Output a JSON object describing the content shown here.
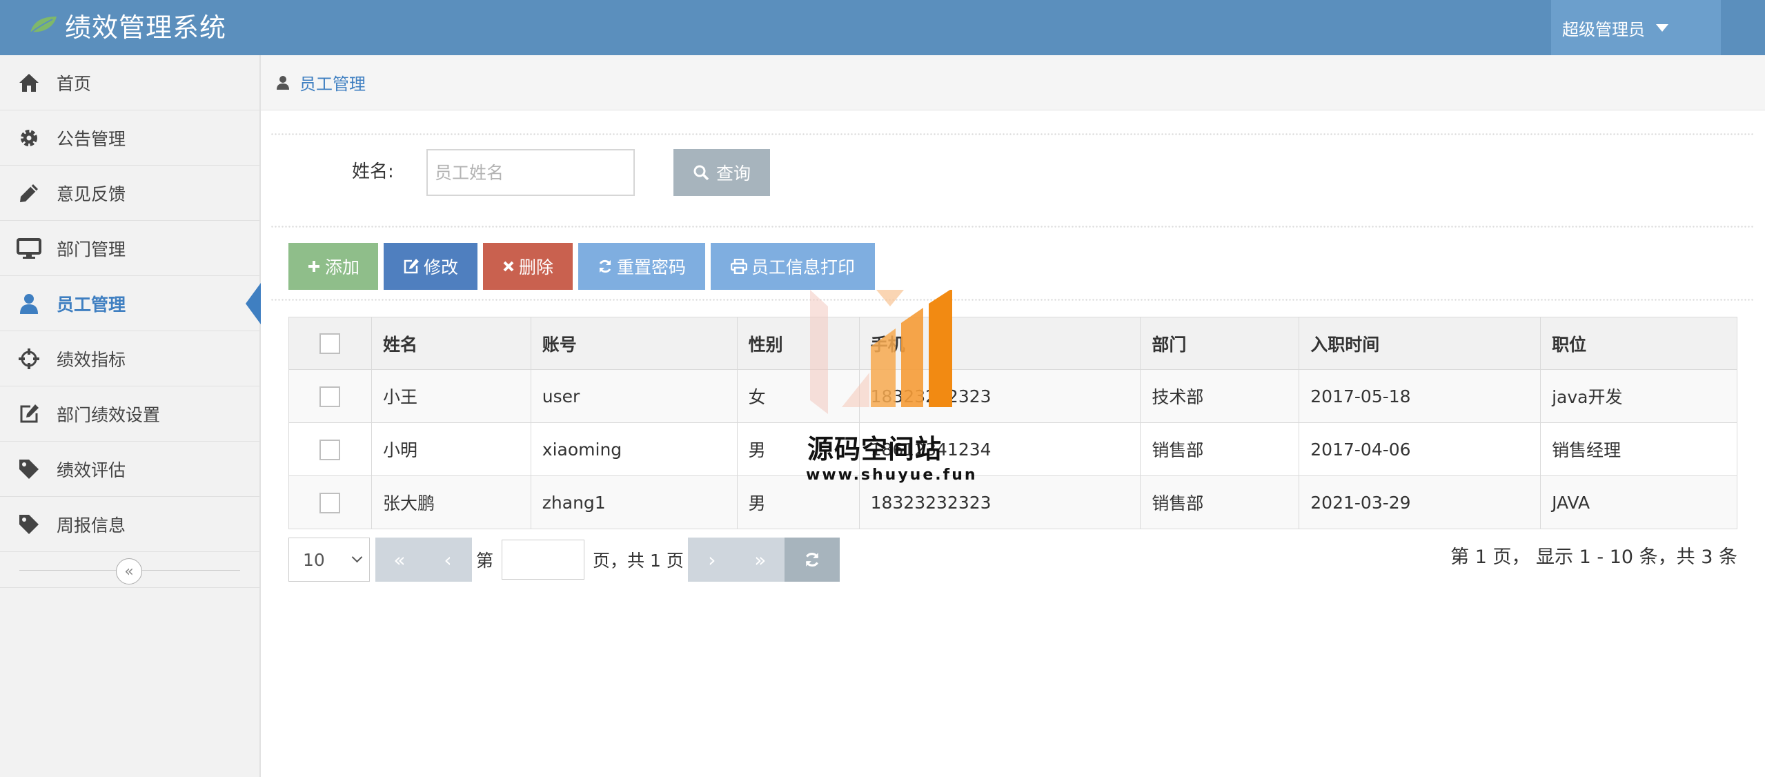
{
  "app": {
    "title": "绩效管理系统"
  },
  "user_menu": {
    "label": "超级管理员"
  },
  "sidebar": {
    "items": [
      {
        "label": "首页",
        "icon": "home-icon"
      },
      {
        "label": "公告管理",
        "icon": "gear-icon"
      },
      {
        "label": "意见反馈",
        "icon": "pencil-icon"
      },
      {
        "label": "部门管理",
        "icon": "desktop-icon"
      },
      {
        "label": "员工管理",
        "icon": "user-icon",
        "active": true
      },
      {
        "label": "绩效指标",
        "icon": "crosshairs-icon"
      },
      {
        "label": "部门绩效设置",
        "icon": "edit-icon"
      },
      {
        "label": "绩效评估",
        "icon": "tag-icon"
      },
      {
        "label": "周报信息",
        "icon": "tag-icon"
      }
    ],
    "collapse_glyph": "«"
  },
  "breadcrumb": {
    "label": "员工管理"
  },
  "search": {
    "label": "姓名:",
    "placeholder": "员工姓名",
    "value": "",
    "button_label": "查询"
  },
  "toolbar": {
    "add_label": "添加",
    "edit_label": "修改",
    "delete_label": "删除",
    "reset_password_label": "重置密码",
    "print_label": "员工信息打印"
  },
  "colors": {
    "header": "#5b8fbd",
    "add": "#8fbe8a",
    "edit": "#4f7fbf",
    "delete": "#c9614f",
    "light": "#7faee0",
    "active": "#3f7fc1"
  },
  "table": {
    "columns": [
      "姓名",
      "账号",
      "性别",
      "手机",
      "部门",
      "入职时间",
      "职位"
    ],
    "rows": [
      [
        "小王",
        "user",
        "女",
        "18323232323",
        "技术部",
        "2017-05-18",
        "java开发"
      ],
      [
        "小明",
        "xiaoming",
        "男",
        "18612341234",
        "销售部",
        "2017-04-06",
        "销售经理"
      ],
      [
        "张大鹏",
        "zhang1",
        "男",
        "18323232323",
        "销售部",
        "2021-03-29",
        "JAVA"
      ]
    ]
  },
  "pager": {
    "page_size": "10",
    "first": "«",
    "prev": "‹",
    "next": "›",
    "last": "»",
    "page_prefix": "第",
    "page_suffix": "页，共 1 页",
    "page_value": "",
    "info": "第 1 页， 显示 1 - 10 条，共 3 条"
  },
  "watermark": {
    "title": "源码空间站",
    "url": "www.shuyue.fun"
  }
}
